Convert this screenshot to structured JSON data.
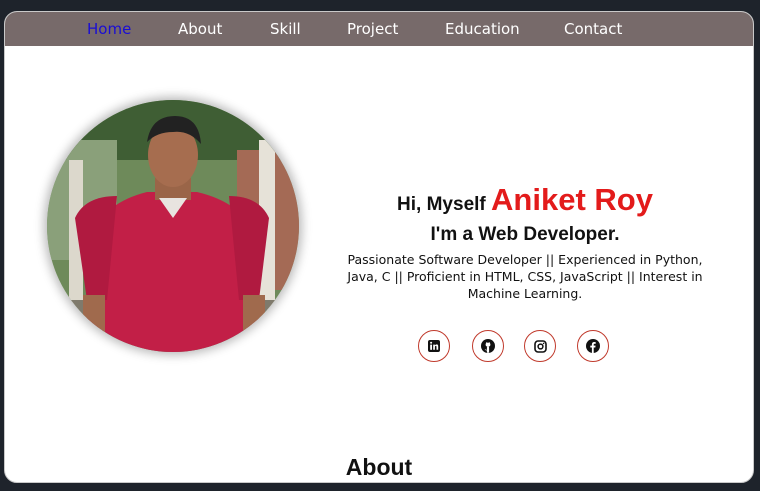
{
  "nav": {
    "items": [
      {
        "label": "Home",
        "active": true
      },
      {
        "label": "About"
      },
      {
        "label": "Skill"
      },
      {
        "label": "Project"
      },
      {
        "label": "Education"
      },
      {
        "label": "Contact"
      }
    ]
  },
  "hero": {
    "greeting_prefix": "Hi, Myself",
    "name": "Aniket Roy",
    "role": "I'm a Web Developer.",
    "description": "Passionate Software Developer || Experienced in Python, Java, C || Proficient in HTML, CSS, JavaScript || Interest in Machine Learning.",
    "profile_photo": "profile-photo"
  },
  "social": [
    {
      "icon": "linkedin-icon"
    },
    {
      "icon": "github-icon"
    },
    {
      "icon": "instagram-icon"
    },
    {
      "icon": "facebook-icon"
    }
  ],
  "about": {
    "heading": "About"
  },
  "colors": {
    "nav_bg": "#776a6a",
    "nav_active": "#1a0dd4",
    "accent_name": "#e31b1b",
    "social_border": "#c0392b"
  }
}
